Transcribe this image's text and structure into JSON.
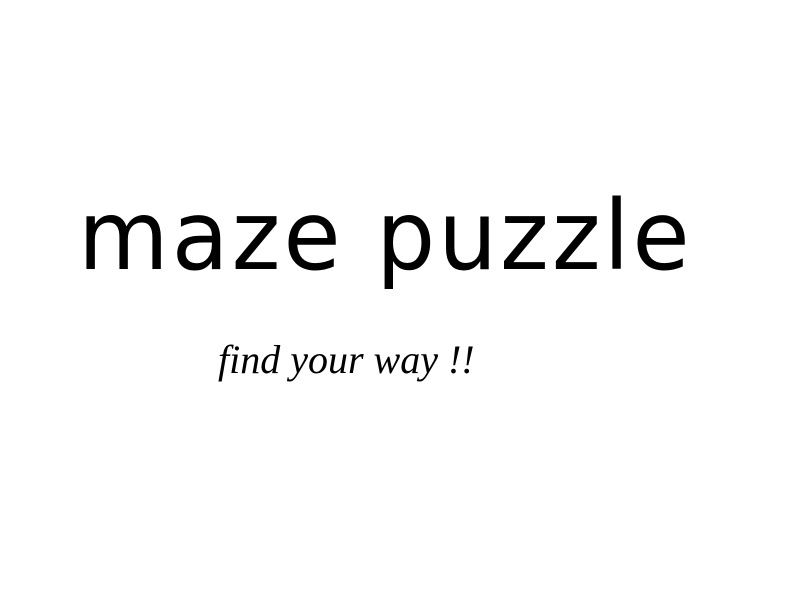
{
  "title_screen": {
    "title": "maze puzzle",
    "subtitle": "find your way !!"
  },
  "colors": {
    "background": "#ffffff",
    "text": "#000000"
  }
}
